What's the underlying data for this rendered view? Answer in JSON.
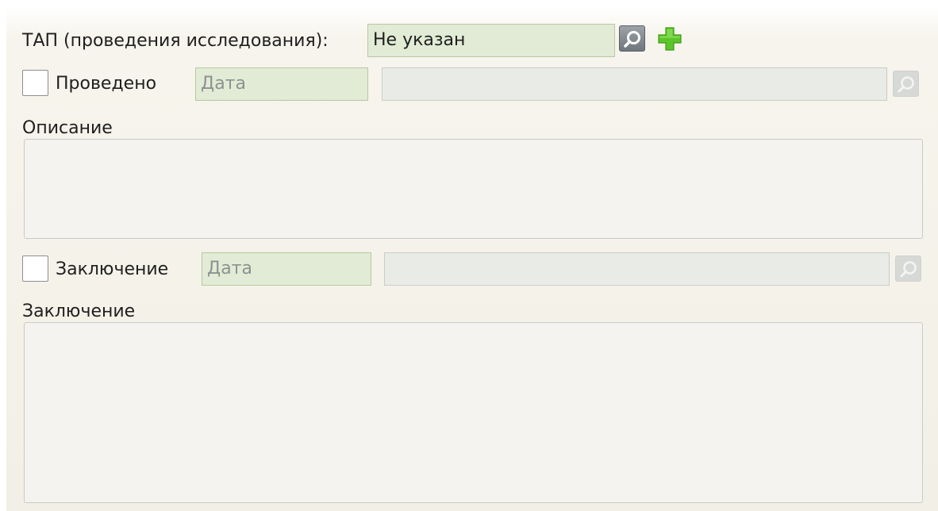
{
  "tap": {
    "label": "ТАП (проведения исследования):",
    "value": "Не указан",
    "search_icon": "search-icon",
    "add_icon": "plus-icon",
    "add_color": "#5cc52a"
  },
  "performed": {
    "checkbox_label": "Проведено",
    "checked": false,
    "date_placeholder": "Дата",
    "search_icon": "search-icon"
  },
  "description": {
    "label": "Описание",
    "value": ""
  },
  "conclusion_row": {
    "checkbox_label": "Заключение",
    "checked": false,
    "date_placeholder": "Дата",
    "search_icon": "search-icon"
  },
  "conclusion": {
    "label": "Заключение",
    "value": ""
  },
  "colors": {
    "field_green": "#e2ebd5",
    "field_grey": "#e8ebe6",
    "panel_bg": "#f2f0e6"
  }
}
